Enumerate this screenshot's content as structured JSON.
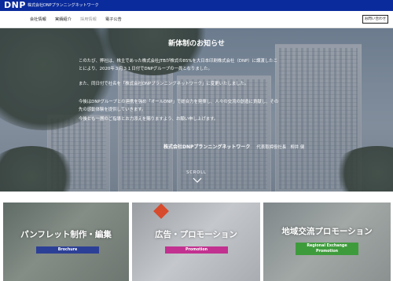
{
  "header": {
    "logo": "DNP",
    "company": "株式会社DNPプランニングネットワーク",
    "bar_color": "#0a2b9c"
  },
  "nav": {
    "items": [
      {
        "label": "会社情報",
        "state": "active"
      },
      {
        "label": "実績紹介",
        "state": "active"
      },
      {
        "label": "採用情報",
        "state": "disabled"
      },
      {
        "label": "電子公告",
        "state": "active"
      }
    ],
    "contact_label": "お問い合わせ"
  },
  "hero": {
    "title": "新体制のお知らせ",
    "paragraphs": [
      "このたび、弊社は、株主であった株式会社JTBが株式の85%を大日本印刷株式会社（DNP）に譲渡したこ",
      "とにより、2020年３月３１日付でDNPグループの一員となりました。",
      "また、同日付で社名を「株式会社DNPプランニングネットワーク」に変更いたしました。",
      "今後はDNPグループとの連携を強め「オールDNP」で総合力を発揮し、人々の交流の創造に貢献し、その",
      "先の感動体験を提供していきます。",
      "今後とも一層のご指導とお力添えを賜りますよう、お願い申し上げます。"
    ],
    "signature_org": "株式会社DNPプランニングネットワーク",
    "signature_rep": "代表取締役社長　柳井 健",
    "scroll_label": "SCROLL"
  },
  "cards": [
    {
      "title": "パンフレット制作・編集",
      "badge": "Brochure",
      "badge_color": "#2c3f96"
    },
    {
      "title": "広告・プロモーション",
      "badge": "Promotion",
      "badge_color": "#c2318f"
    },
    {
      "title": "地域交流プロモーション",
      "badge_line1": "Regional Exchange",
      "badge_line2": "Promotion",
      "badge_color": "#3e9b3c"
    }
  ]
}
